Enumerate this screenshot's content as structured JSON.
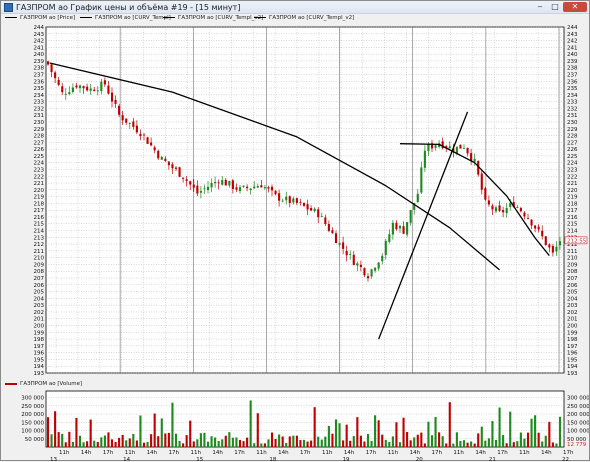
{
  "window": {
    "title": "ГАЗПРОМ ао График цены и объёма #19 - [15 минут]",
    "close_glyph": "✕",
    "max_glyph": "□",
    "min_glyph": "‒"
  },
  "legend": {
    "price": "ГАЗПРОМ ао [Price]",
    "curv1": "ГАЗПРОМ ао [CURV_Templ]",
    "curv2": "ГАЗПРОМ ао [CURV_Templ_v2]",
    "curv3": "ГАЗПРОМ ао [CURV_Templ_v2]",
    "volume": "ГАЗПРОМ ао [Volume]"
  },
  "colors": {
    "up": "#1e8a1e",
    "down": "#c00000",
    "grid": "#a0a0a0",
    "line": "#000000",
    "last_price": "#d42020"
  },
  "chart_data": [
    {
      "type": "candlestick",
      "name": "price",
      "ylim": [
        193,
        244
      ],
      "y_ticks": [
        193,
        194,
        195,
        196,
        197,
        198,
        199,
        200,
        201,
        202,
        203,
        204,
        205,
        206,
        207,
        208,
        209,
        210,
        211,
        212,
        213,
        214,
        215,
        216,
        217,
        218,
        219,
        220,
        221,
        222,
        223,
        224,
        225,
        226,
        227,
        228,
        229,
        230,
        231,
        232,
        233,
        234,
        235,
        236,
        237,
        238,
        239,
        240,
        241,
        242,
        243,
        244
      ],
      "last_price": "212.55",
      "x_ticks": [
        "11h",
        "14h",
        "17h",
        "11h",
        "14h",
        "17h",
        "11h",
        "14h",
        "17h",
        "11h",
        "14h",
        "17h",
        "11h",
        "14h",
        "17h",
        "11h",
        "14h",
        "17h",
        "11h",
        "14h",
        "17h",
        "11h",
        "14h",
        "17h"
      ],
      "date_labels": [
        "13",
        "14",
        "15",
        "18",
        "19",
        "20",
        "21",
        "22"
      ],
      "overlays": [
        {
          "name": "curve-1",
          "points": [
            [
              0.5,
              238.7
            ],
            [
              35,
              234.4
            ],
            [
              70,
              227.8
            ],
            [
              95,
              220.6
            ],
            [
              113,
              214.4
            ],
            [
              127,
              208.2
            ]
          ]
        },
        {
          "name": "curve-2",
          "points": [
            [
              99,
              226.8
            ],
            [
              110,
              226.7
            ],
            [
              120,
              224.0
            ],
            [
              129,
              219.1
            ],
            [
              137,
              212.9
            ],
            [
              141,
              210.3
            ]
          ]
        },
        {
          "name": "trend-line",
          "points": [
            [
              93,
              198.0
            ],
            [
              118,
              231.5
            ]
          ]
        }
      ]
    },
    {
      "type": "bar",
      "name": "volume",
      "y_ticks": [
        "300 000",
        "250 000",
        "200 000",
        "150 000",
        "100 000",
        "50 000"
      ],
      "tick_values": [
        300000,
        250000,
        200000,
        150000,
        100000,
        50000
      ],
      "last_volume": "12 779",
      "ylim": [
        0,
        340000
      ]
    }
  ]
}
